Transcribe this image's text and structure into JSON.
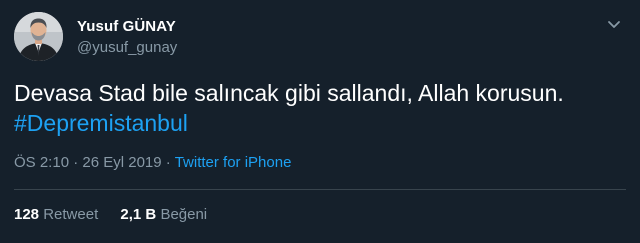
{
  "author": {
    "name": "Yusuf GÜNAY",
    "handle": "@yusuf_gunay"
  },
  "tweet": {
    "text_line1": "Devasa Stad bile salıncak gibi sallandı, Allah korusun.",
    "hashtag": "#Depremistanbul"
  },
  "meta": {
    "time": "ÖS 2:10",
    "separator1": " · ",
    "date": "26 Eyl 2019",
    "separator2": " · ",
    "source": "Twitter for iPhone"
  },
  "stats": {
    "retweets_count": "128",
    "retweets_label": "Retweet",
    "likes_count": "2,1 B",
    "likes_label": "Beğeni"
  },
  "colors": {
    "background": "#15202b",
    "accent": "#1da1f2",
    "secondary_text": "#8899a6"
  },
  "icons": {
    "menu": "chevron-down-icon"
  }
}
